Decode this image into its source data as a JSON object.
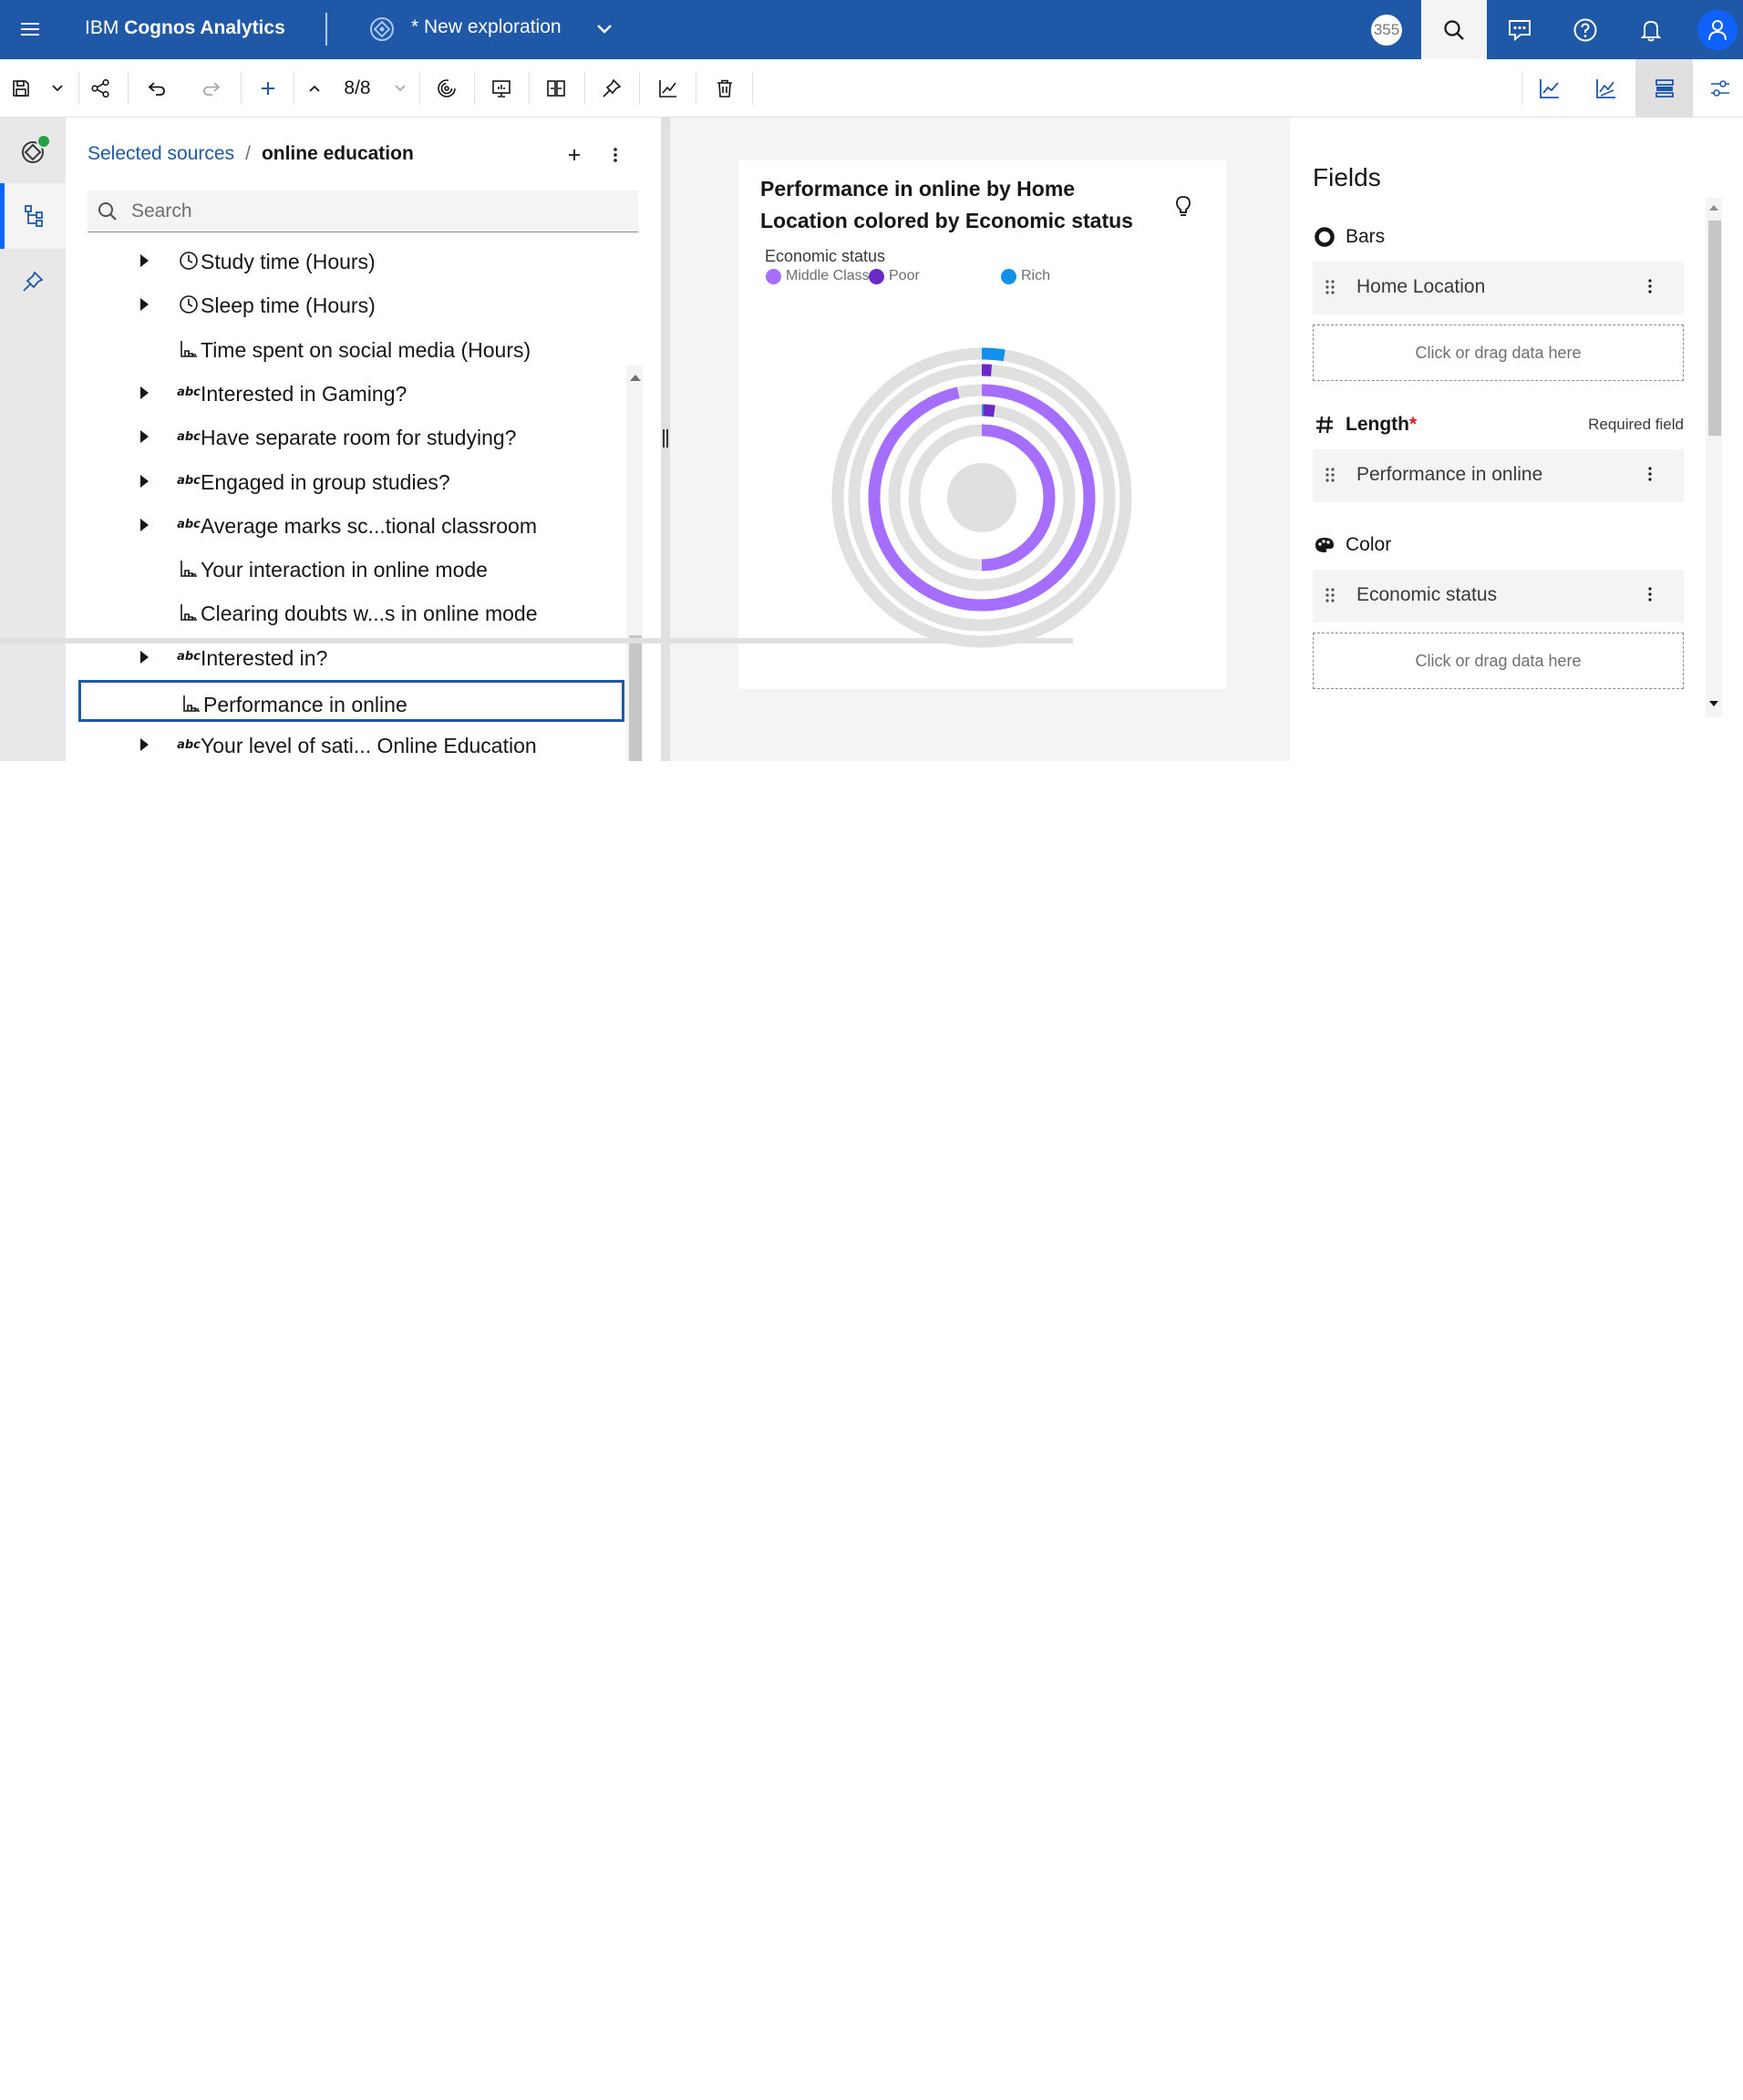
{
  "topbar": {
    "brand_prefix": "IBM ",
    "brand_name": "Cognos Analytics",
    "exploration_title": "* New exploration",
    "badge_count": "355"
  },
  "toolbar": {
    "page_count": "8/8"
  },
  "sources": {
    "breadcrumb_link": "Selected sources",
    "breadcrumb_sep": "/",
    "breadcrumb_current": "online education",
    "search_placeholder": "Search",
    "items": [
      {
        "label": "Study time (Hours)",
        "icon": "clock-icon",
        "expandable": true
      },
      {
        "label": "Sleep time (Hours)",
        "icon": "clock-icon",
        "expandable": true
      },
      {
        "label": "Time spent on social media (Hours)",
        "icon": "measure-icon",
        "expandable": false
      },
      {
        "label": "Interested in Gaming?",
        "icon": "abc-icon",
        "expandable": true
      },
      {
        "label": "Have separate room for studying?",
        "icon": "abc-icon",
        "expandable": true
      },
      {
        "label": "Engaged in group studies?",
        "icon": "abc-icon",
        "expandable": true
      },
      {
        "label": "Average marks sc...tional classroom",
        "icon": "abc-icon",
        "expandable": true
      },
      {
        "label": "Your interaction in online mode",
        "icon": "measure-icon",
        "expandable": false
      },
      {
        "label": "Clearing doubts w...s in online mode",
        "icon": "measure-icon",
        "expandable": false
      },
      {
        "label": "Interested in?",
        "icon": "abc-icon",
        "expandable": true
      },
      {
        "label": "Performance in online",
        "icon": "measure-icon",
        "expandable": false,
        "selected": true
      },
      {
        "label": "Your level of sati... Online Education",
        "icon": "abc-icon",
        "expandable": true
      }
    ],
    "abc_glyph": "abc"
  },
  "chart": {
    "title": "Performance in online by Home Location colored by Economic status",
    "legend_title": "Economic status",
    "legend": [
      {
        "name": "Middle Class",
        "color": "#a56eff"
      },
      {
        "name": "Poor",
        "color": "#6929c4"
      },
      {
        "name": "Rich",
        "color": "#1192e8"
      }
    ]
  },
  "chart_data": {
    "type": "radial-bar",
    "title": "Performance in online by Home Location colored by Economic status",
    "legend_title": "Economic status",
    "series": [
      {
        "name": "Middle Class",
        "color": "#a56eff"
      },
      {
        "name": "Poor",
        "color": "#6929c4"
      },
      {
        "name": "Rich",
        "color": "#1192e8"
      }
    ],
    "rings": [
      {
        "segments": [
          {
            "series": "Rich",
            "fraction": 0.025
          }
        ]
      },
      {
        "segments": [
          {
            "series": "Poor",
            "fraction": 0.012
          }
        ]
      },
      {
        "segments": [
          {
            "series": "Middle Class",
            "fraction": 0.965
          }
        ]
      },
      {
        "segments": [
          {
            "series": "Rich",
            "fraction": 0.003
          },
          {
            "series": "Poor",
            "fraction": 0.02
          }
        ]
      },
      {
        "segments": [
          {
            "series": "Middle Class",
            "fraction": 0.5
          }
        ]
      }
    ]
  },
  "fields": {
    "title": "Fields",
    "bars_label": "Bars",
    "bars_value": "Home Location",
    "length_label": "Length",
    "length_required_mark": "*",
    "required_note": "Required field",
    "length_value": "Performance in online",
    "color_label": "Color",
    "color_value": "Economic status",
    "drop_hint": "Click or drag data here"
  }
}
